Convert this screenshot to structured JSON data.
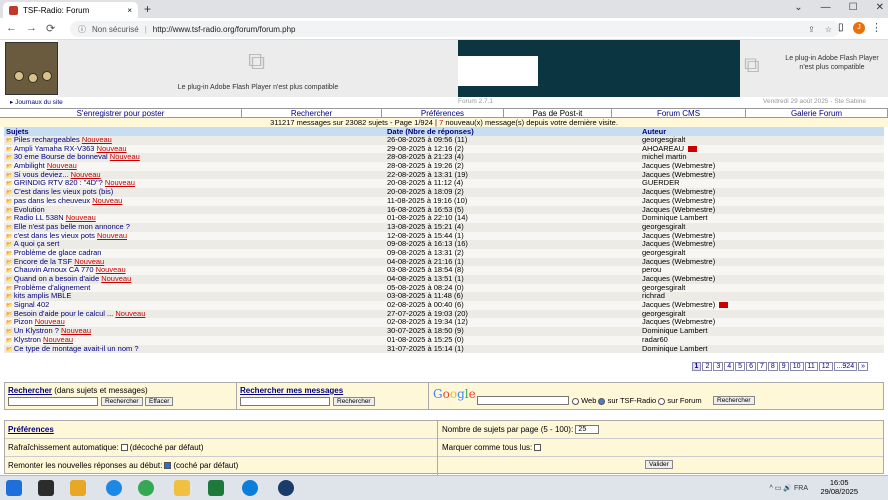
{
  "browser": {
    "tab_title": "TSF-Radio: Forum",
    "tab_close": "×",
    "new_tab": "+",
    "window_controls": [
      "⌄",
      "—",
      "☐",
      "✕"
    ],
    "nav": [
      "←",
      "→",
      "⟳"
    ],
    "security": "Non sécurisé",
    "url": "http://www.tsf-radio.org/forum/forum.php",
    "profile_initial": "J",
    "menu": "⋮"
  },
  "header": {
    "journal_link": "Journaux du site",
    "flash_msg_1": "Le plug-in Adobe Flash Player n'est plus compatible",
    "flash_msg_2": "Le plug-in Adobe Flash Player n'est plus compatible",
    "version": "Forum 2.7.1",
    "date": "Vendredi 29 août 2025 - Ste Sabine"
  },
  "nav": [
    "S'enregistrer pour poster",
    "Rechercher",
    "Préférences",
    "Pas de Post-it",
    "Forum CMS",
    "Galerie Forum"
  ],
  "stats": {
    "prefix": "311217 messages sur 23082 sujets - Page 1/924 | ",
    "count": "7",
    "suffix": " nouveau(x) message(s) depuis votre dernière visite."
  },
  "table": {
    "headers": [
      "Sujets",
      "Date (Nbre de réponses)",
      "Auteur"
    ],
    "new_label": "Nouveau",
    "rows": [
      {
        "subject": "Piles rechargeables",
        "new": true,
        "date": "26-08-2025 à 09:56 (11)",
        "author": "georgesgiralt",
        "mail": false
      },
      {
        "subject": "Ampli Yamaha RX-V363",
        "new": true,
        "date": "29-08-2025 à 12:16 (2)",
        "author": "AHOAREAU",
        "mail": true
      },
      {
        "subject": "30 eme Bourse de bonneval",
        "new": true,
        "date": "28-08-2025 à 21:23 (4)",
        "author": "michel martin",
        "mail": false
      },
      {
        "subject": "Ambilight",
        "new": true,
        "date": "28-08-2025 à 19:26 (2)",
        "author": "Jacques (Webmestre)",
        "mail": false
      },
      {
        "subject": "Si vous deviez...",
        "new": true,
        "date": "22-08-2025 à 13:31 (19)",
        "author": "Jacques (Webmestre)",
        "mail": false
      },
      {
        "subject": "GRINDIG RTV 820 : \"4D\"?",
        "new": true,
        "date": "20-08-2025 à 11:12 (4)",
        "author": "GUERDER",
        "mail": false
      },
      {
        "subject": "C'est dans les vieux pots (bis)",
        "new": false,
        "date": "20-08-2025 à 18:09 (2)",
        "author": "Jacques (Webmestre)",
        "mail": false
      },
      {
        "subject": "pas dans les cheuveux",
        "new": true,
        "date": "11-08-2025 à 19:16 (10)",
        "author": "Jacques (Webmestre)",
        "mail": false
      },
      {
        "subject": "Evolution",
        "new": false,
        "date": "16-08-2025 à 16:53 (5)",
        "author": "Jacques (Webmestre)",
        "mail": false
      },
      {
        "subject": "Radio LL 538N",
        "new": true,
        "date": "01-08-2025 à 22:10 (14)",
        "author": "Dominique Lambert",
        "mail": false
      },
      {
        "subject": "Elle n'est pas belle mon annonce ?",
        "new": false,
        "date": "13-08-2025 à 15:21 (4)",
        "author": "georgesgiralt",
        "mail": false
      },
      {
        "subject": "c'est dans les vieux pots",
        "new": true,
        "date": "12-08-2025 à 15:44 (1)",
        "author": "Jacques (Webmestre)",
        "mail": false
      },
      {
        "subject": "A quoi ça sert",
        "new": false,
        "date": "09-08-2025 à 16:13 (16)",
        "author": "Jacques (Webmestre)",
        "mail": false
      },
      {
        "subject": "Problème de glace cadran",
        "new": false,
        "date": "09-08-2025 à 13:31 (2)",
        "author": "georgesgiralt",
        "mail": false
      },
      {
        "subject": "Encore de la TSF",
        "new": true,
        "date": "04-08-2025 à 21:16 (1)",
        "author": "Jacques (Webmestre)",
        "mail": false
      },
      {
        "subject": "Chauvin Arnoux CA 770",
        "new": true,
        "date": "03-08-2025 à 18:54 (8)",
        "author": "perou",
        "mail": false
      },
      {
        "subject": "Quand on a besoin d'aide",
        "new": true,
        "date": "04-08-2025 à 13:51 (1)",
        "author": "Jacques (Webmestre)",
        "mail": false
      },
      {
        "subject": "Problème d'alignement",
        "new": false,
        "date": "05-08-2025 à 08:24 (0)",
        "author": "georgesgiralt",
        "mail": false
      },
      {
        "subject": "kits amplis MBLE",
        "new": false,
        "date": "03-08-2025 à 11:48 (6)",
        "author": "richrad",
        "mail": false
      },
      {
        "subject": "Signal 402",
        "new": false,
        "date": "02-08-2025 à 00:40 (6)",
        "author": "Jacques (Webmestre)",
        "mail": true
      },
      {
        "subject": "Besoin d'aide pour le calcul ...",
        "new": true,
        "date": "27-07-2025 à 19:03 (20)",
        "author": "georgesgiralt",
        "mail": false
      },
      {
        "subject": "Pizon",
        "new": true,
        "date": "02-08-2025 à 19:34 (12)",
        "author": "Jacques (Webmestre)",
        "mail": false
      },
      {
        "subject": "Un Klystron ?",
        "new": true,
        "date": "30-07-2025 à 18:50 (9)",
        "author": "Dominique Lambert",
        "mail": false
      },
      {
        "subject": "Klystron",
        "new": true,
        "date": "01-08-2025 à 15:25 (0)",
        "author": "radar60",
        "mail": false
      },
      {
        "subject": "Ce type de montage avait-il un nom ?",
        "new": false,
        "date": "31-07-2025 à 15:14 (1)",
        "author": "Dominique Lambert",
        "mail": false
      }
    ]
  },
  "pager": [
    "1",
    "2",
    "3",
    "4",
    "5",
    "6",
    "7",
    "8",
    "9",
    "10",
    "11",
    "12",
    "...924",
    "»"
  ],
  "search": {
    "title1": "Rechercher",
    "sub1": " (dans sujets et messages)",
    "btn_search": "Rechercher",
    "btn_clear": "Effacer",
    "title2": "Rechercher mes messages",
    "btn_search2": "Rechercher",
    "google": "Google",
    "opt_web": "Web",
    "opt_tsf": "sur TSF-Radio",
    "opt_forum": "sur Forum",
    "btn_google": "Rechercher"
  },
  "prefs": {
    "title": "Préférences",
    "refresh": "Rafraîchissement automatique:",
    "refresh_note": "(décoché par défaut)",
    "nb_label": "Nombre de sujets par page (5 - 100):",
    "nb_value": "25",
    "mark_read": "Marquer comme tous lus:",
    "push_new": "Remonter les nouvelles réponses au début:",
    "push_note": "(coché par défaut)",
    "validate": "Valider"
  },
  "taskbar": {
    "time": "16:05",
    "date": "29/08/2025",
    "tray": "^ ▭ 🔊 FRA"
  }
}
